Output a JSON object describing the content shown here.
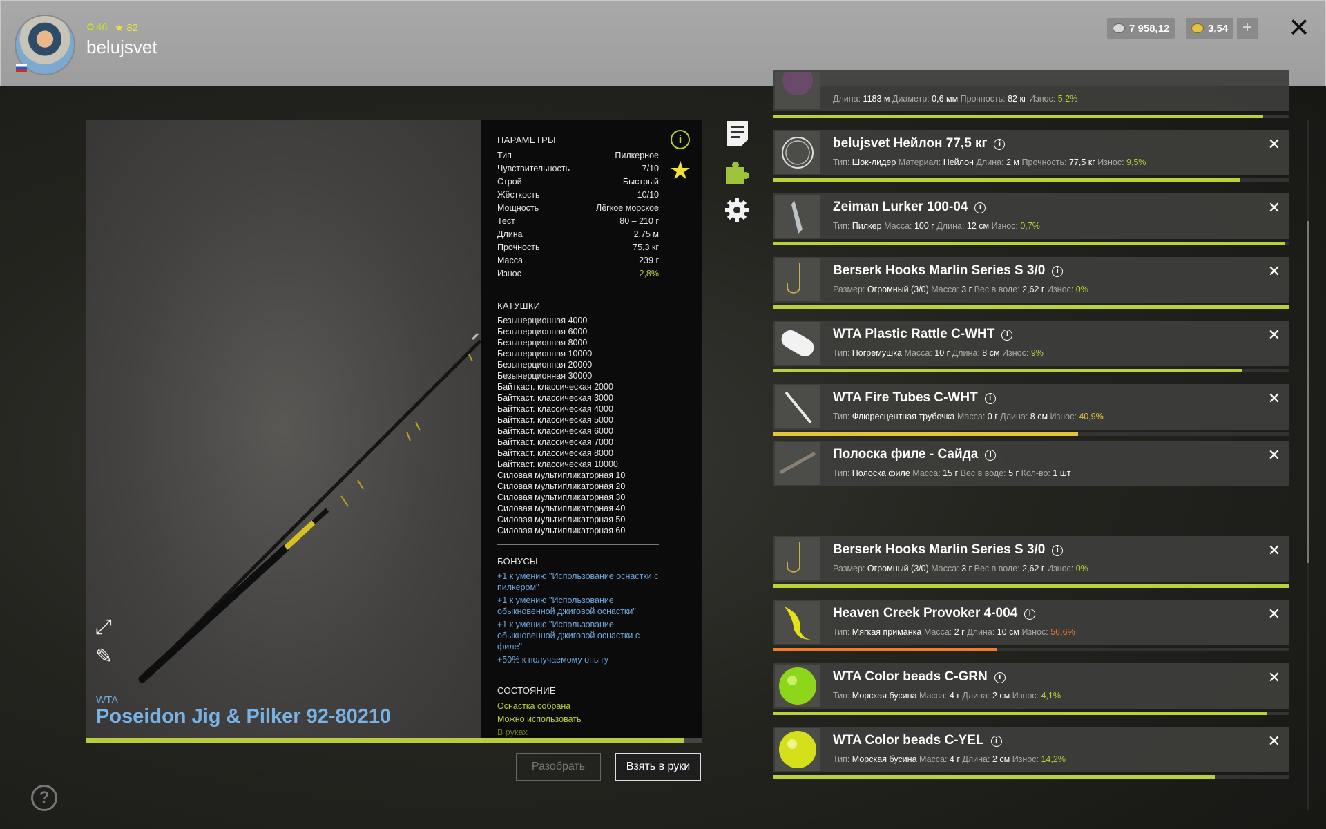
{
  "header": {
    "level": "46",
    "rating": "82",
    "username": "belujsvet",
    "silver": "7 958,12",
    "gold": "3,54",
    "plus": "+",
    "close": "✕"
  },
  "rod": {
    "brand": "WTA",
    "name": "Poseidon Jig & Pilker 92-80210",
    "wear_fraction": 0.972
  },
  "params": {
    "title": "ПАРАМЕТРЫ",
    "rows": [
      {
        "label": "Тип",
        "value": "Пилкерное"
      },
      {
        "label": "Чувствительность",
        "value": "7/10"
      },
      {
        "label": "Строй",
        "value": "Быстрый"
      },
      {
        "label": "Жёсткость",
        "value": "10/10"
      },
      {
        "label": "Мощность",
        "value": "Лёгкое морское"
      },
      {
        "label": "Тест",
        "value": "80 – 210 г"
      },
      {
        "label": "Длина",
        "value": "2,75 м"
      },
      {
        "label": "Прочность",
        "value": "75,3 кг"
      },
      {
        "label": "Масса",
        "value": "239 г"
      },
      {
        "label": "Износ",
        "value": "2,8%"
      }
    ],
    "reels_title": "КАТУШКИ",
    "reels": [
      "Безынерционная 4000",
      "Безынерционная 6000",
      "Безынерционная 8000",
      "Безынерционная 10000",
      "Безынерционная 20000",
      "Безынерционная 30000",
      "Байткаст. классическая 2000",
      "Байткаст. классическая 3000",
      "Байткаст. классическая 4000",
      "Байткаст. классическая 5000",
      "Байткаст. классическая 6000",
      "Байткаст. классическая 7000",
      "Байткаст. классическая 8000",
      "Байткаст. классическая 10000",
      "Силовая мультипликаторная 10",
      "Силовая мультипликаторная 20",
      "Силовая мультипликаторная 30",
      "Силовая мультипликаторная 40",
      "Силовая мультипликаторная 50",
      "Силовая мультипликаторная 60"
    ],
    "bonuses_title": "БОНУСЫ",
    "bonuses": [
      "+1 к умению \"Использование оснастки с пилкером\"",
      "+1 к умению \"Использование обыкновенной джиговой оснастки\"",
      "+1 к умению \"Использование обыкновенной джиговой оснастки с филе\"",
      "+50% к получаемому опыту"
    ],
    "state_title": "СОСТОЯНИЕ",
    "states": [
      "Оснастка собрана",
      "Можно использовать",
      "В руках"
    ]
  },
  "buttons": {
    "disassemble": "Разобрать",
    "take": "Взять в руки",
    "help": "?"
  },
  "items": [
    {
      "title": "",
      "desc": [
        [
          "Длина:",
          "1183 м"
        ],
        [
          "Диаметр:",
          "0,6 мм"
        ],
        [
          "Прочность:",
          "82 кг"
        ],
        [
          "Износ:",
          "5,2%"
        ]
      ],
      "wear_color": "g",
      "wear": 0.95,
      "show_x": false
    },
    {
      "title": "belujsvet Нейлон 77,5 кг",
      "desc": [
        [
          "Тип:",
          "Шок-лидер"
        ],
        [
          "Материал:",
          "Нейлон"
        ],
        [
          "Длина:",
          "2 м"
        ],
        [
          "Прочность:",
          "77,5 кг"
        ],
        [
          "Износ:",
          "9,5%"
        ]
      ],
      "wear_color": "g",
      "wear": 0.905,
      "show_x": true
    },
    {
      "title": "Zeiman Lurker 100-04",
      "desc": [
        [
          "Тип:",
          "Пилкер"
        ],
        [
          "Масса:",
          "100 г"
        ],
        [
          "Длина:",
          "12 см"
        ],
        [
          "Износ:",
          "0,7%"
        ]
      ],
      "wear_color": "g",
      "wear": 0.993,
      "show_x": true
    },
    {
      "title": "Berserk Hooks Marlin Series S 3/0",
      "desc": [
        [
          "Размер:",
          "Огромный (3/0)"
        ],
        [
          "Масса:",
          "3 г"
        ],
        [
          "Вес в воде:",
          "2,62 г"
        ],
        [
          "Износ:",
          "0%"
        ]
      ],
      "wear_color": "g",
      "wear": 1.0,
      "show_x": true
    },
    {
      "title": "WTA Plastic Rattle C-WHT",
      "desc": [
        [
          "Тип:",
          "Погремушка"
        ],
        [
          "Масса:",
          "10 г"
        ],
        [
          "Длина:",
          "8 см"
        ],
        [
          "Износ:",
          "9%"
        ]
      ],
      "wear_color": "g",
      "wear": 0.91,
      "show_x": true
    },
    {
      "title": "WTA Fire Tubes C-WHT",
      "desc": [
        [
          "Тип:",
          "Флюресцентная трубочка"
        ],
        [
          "Масса:",
          "0 г"
        ],
        [
          "Длина:",
          "8 см"
        ],
        [
          "Износ:",
          "40,9%"
        ]
      ],
      "wear_color": "y",
      "wear": 0.591,
      "show_x": true
    },
    {
      "title": "Полоска филе - Сайда",
      "desc": [
        [
          "Тип:",
          "Полоска филе"
        ],
        [
          "Масса:",
          "15 г"
        ],
        [
          "Вес в воде:",
          "5 г"
        ],
        [
          "Кол-во:",
          "1 шт"
        ]
      ],
      "wear_color": "none",
      "wear": 0,
      "show_x": true
    },
    {
      "title": "Berserk Hooks Marlin Series S 3/0",
      "desc": [
        [
          "Размер:",
          "Огромный (3/0)"
        ],
        [
          "Масса:",
          "3 г"
        ],
        [
          "Вес в воде:",
          "2,62 г"
        ],
        [
          "Износ:",
          "0%"
        ]
      ],
      "wear_color": "g",
      "wear": 1.0,
      "show_x": true
    },
    {
      "title": "Heaven Creek Provoker 4-004",
      "desc": [
        [
          "Тип:",
          "Мягкая приманка"
        ],
        [
          "Масса:",
          "2 г"
        ],
        [
          "Длина:",
          "10 см"
        ],
        [
          "Износ:",
          "56,6%"
        ]
      ],
      "wear_color": "o",
      "wear": 0.434,
      "show_x": true
    },
    {
      "title": "WTA Color beads C-GRN",
      "desc": [
        [
          "Тип:",
          "Морская бусина"
        ],
        [
          "Масса:",
          "4 г"
        ],
        [
          "Длина:",
          "2 см"
        ],
        [
          "Износ:",
          "4,1%"
        ]
      ],
      "wear_color": "g",
      "wear": 0.959,
      "show_x": true
    },
    {
      "title": "WTA Color beads C-YEL",
      "desc": [
        [
          "Тип:",
          "Морская бусина"
        ],
        [
          "Масса:",
          "4 г"
        ],
        [
          "Длина:",
          "2 см"
        ],
        [
          "Износ:",
          "14,2%"
        ]
      ],
      "wear_color": "g",
      "wear": 0.858,
      "show_x": true
    }
  ],
  "colors": {
    "accent_green": "#b9d23a",
    "accent_yellow": "#e3c43a",
    "accent_orange": "#f07b2a",
    "link_blue": "#6fa8dc"
  }
}
